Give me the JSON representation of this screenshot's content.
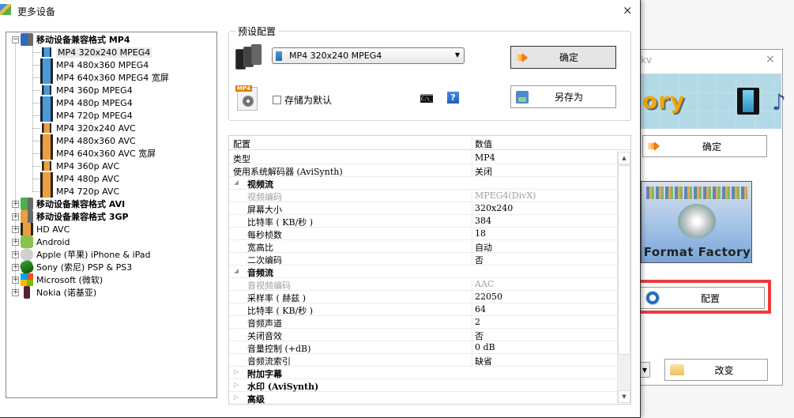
{
  "background_window": {
    "title_fragment": "kv",
    "close": "×",
    "banner_text": "ory",
    "ok_label": "确定",
    "logo_text": "Format Factory",
    "config_label": "配置",
    "change_label": "改变"
  },
  "dialog": {
    "title": "更多设备",
    "close": "×"
  },
  "tree": {
    "groups": [
      {
        "label": "移动设备兼容格式 MP4",
        "expanded": true,
        "children": [
          {
            "label": "MP4 320x240 MPEG4",
            "selected": true
          },
          {
            "label": "MP4 480x360 MPEG4"
          },
          {
            "label": "MP4 640x360 MPEG4 宽屏"
          },
          {
            "label": "MP4 360p MPEG4"
          },
          {
            "label": "MP4 480p MPEG4"
          },
          {
            "label": "MP4 720p MPEG4"
          },
          {
            "label": "MP4 320x240 AVC"
          },
          {
            "label": "MP4 480x360 AVC"
          },
          {
            "label": "MP4 640x360 AVC 宽屏"
          },
          {
            "label": "MP4 360p AVC"
          },
          {
            "label": "MP4 480p AVC"
          },
          {
            "label": "MP4 720p AVC"
          }
        ]
      },
      {
        "label": "移动设备兼容格式 AVI",
        "expanded": false
      },
      {
        "label": "移动设备兼容格式 3GP",
        "expanded": false
      },
      {
        "label": "HD AVC",
        "expanded": false
      },
      {
        "label": "Android",
        "expanded": false
      },
      {
        "label": "Apple (苹果) iPhone & iPad",
        "expanded": false
      },
      {
        "label": "Sony (索尼) PSP & PS3",
        "expanded": false
      },
      {
        "label": "Microsoft (微软)",
        "expanded": false
      },
      {
        "label": "Nokia (诺基亚)",
        "expanded": false
      }
    ]
  },
  "preset": {
    "legend": "预设配置",
    "selected": "MP4 320x240 MPEG4",
    "save_default_label": "存储为默认",
    "save_default_checked": false,
    "cmd_icon_text": "C:\\_",
    "help_icon_text": "?",
    "ok_label": "确定",
    "save_as_label": "另存为"
  },
  "grid": {
    "headers": {
      "key": "配置",
      "value": "数值"
    },
    "rows": [
      {
        "type": "row",
        "key": "类型",
        "value": "MP4"
      },
      {
        "type": "row",
        "key": "使用系统解码器 (AviSynth)",
        "value": "关闭"
      },
      {
        "type": "category",
        "key": "视频流",
        "expanded": true
      },
      {
        "type": "sub",
        "key": "视频编码",
        "value": "MPEG4(DivX)",
        "disabled": true
      },
      {
        "type": "sub",
        "key": "屏幕大小",
        "value": "320x240"
      },
      {
        "type": "sub",
        "key": "比特率 ( KB/秒 )",
        "value": "384"
      },
      {
        "type": "sub",
        "key": "每秒桢数",
        "value": "18"
      },
      {
        "type": "sub",
        "key": "宽高比",
        "value": "自动"
      },
      {
        "type": "sub",
        "key": "二次编码",
        "value": "否"
      },
      {
        "type": "category",
        "key": "音频流",
        "expanded": true
      },
      {
        "type": "sub",
        "key": "音视频编码",
        "value": "AAC",
        "disabled": true
      },
      {
        "type": "sub",
        "key": "采样率 ( 赫兹 )",
        "value": "22050"
      },
      {
        "type": "sub",
        "key": "比特率 ( KB/秒 )",
        "value": "64"
      },
      {
        "type": "sub",
        "key": "音频声道",
        "value": "2"
      },
      {
        "type": "sub",
        "key": "关闭音效",
        "value": "否"
      },
      {
        "type": "sub",
        "key": "音量控制 (+dB)",
        "value": "0 dB"
      },
      {
        "type": "sub",
        "key": "音频流索引",
        "value": "缺省"
      },
      {
        "type": "category",
        "key": "附加字幕",
        "expanded": false
      },
      {
        "type": "category",
        "key": "水印 (AviSynth)",
        "expanded": false
      },
      {
        "type": "category",
        "key": "高级",
        "expanded": false
      }
    ]
  },
  "colors": {
    "highlight_border": "#f03a3a",
    "ok_button_bg": "#e5e5e5"
  }
}
